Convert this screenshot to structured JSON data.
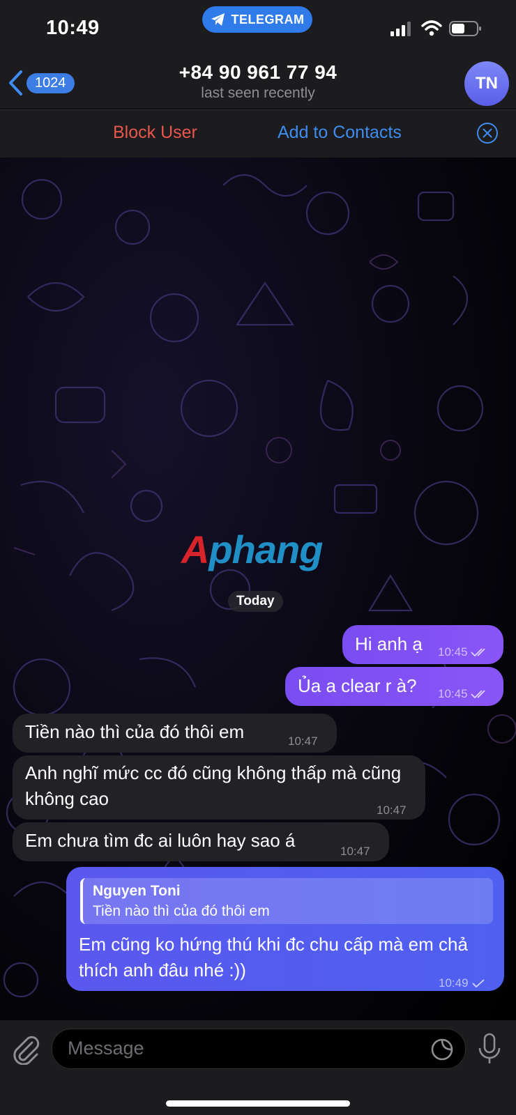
{
  "status_bar": {
    "time": "10:49",
    "app_pill": "TELEGRAM"
  },
  "header": {
    "back_count": "1024",
    "title": "+84 90 961 77 94",
    "subtitle": "last seen recently",
    "avatar_initials": "TN"
  },
  "actions": {
    "block_label": "Block User",
    "add_label": "Add to Contacts"
  },
  "chat": {
    "watermark_first": "A",
    "watermark_rest": "phang",
    "date_label": "Today",
    "messages": [
      {
        "direction": "out",
        "text": "Hi anh ạ",
        "time": "10:45",
        "status": "read"
      },
      {
        "direction": "out",
        "text": "Ủa a clear r à?",
        "time": "10:45",
        "status": "read"
      },
      {
        "direction": "in",
        "text": "Tiền nào thì của đó thôi em",
        "time": "10:47"
      },
      {
        "direction": "in",
        "text": "Anh nghĩ mức cc đó cũng không thấp mà cũng không cao",
        "time": "10:47"
      },
      {
        "direction": "in",
        "text": "Em chưa tìm đc ai luôn hay sao á",
        "time": "10:47"
      },
      {
        "direction": "out",
        "reply_name": "Nguyen Toni",
        "reply_text": "Tiền nào thì của đó thôi em",
        "text": "Em cũng ko hứng thú khi đc chu cấp mà em chả thích anh đâu nhé :))",
        "time": "10:49",
        "status": "sent"
      }
    ]
  },
  "input": {
    "placeholder": "Message"
  },
  "colors": {
    "accent": "#3d7ee6",
    "block": "#e9564d",
    "add": "#3e8cf0",
    "outgoing": "#8a55f6",
    "incoming": "#222226"
  },
  "icons": [
    "telegram-plane-icon",
    "signal-icon",
    "wifi-icon",
    "battery-icon",
    "back-chevron-icon",
    "close-circle-icon",
    "double-check-icon",
    "single-check-icon",
    "paperclip-icon",
    "sticker-icon",
    "microphone-icon"
  ]
}
